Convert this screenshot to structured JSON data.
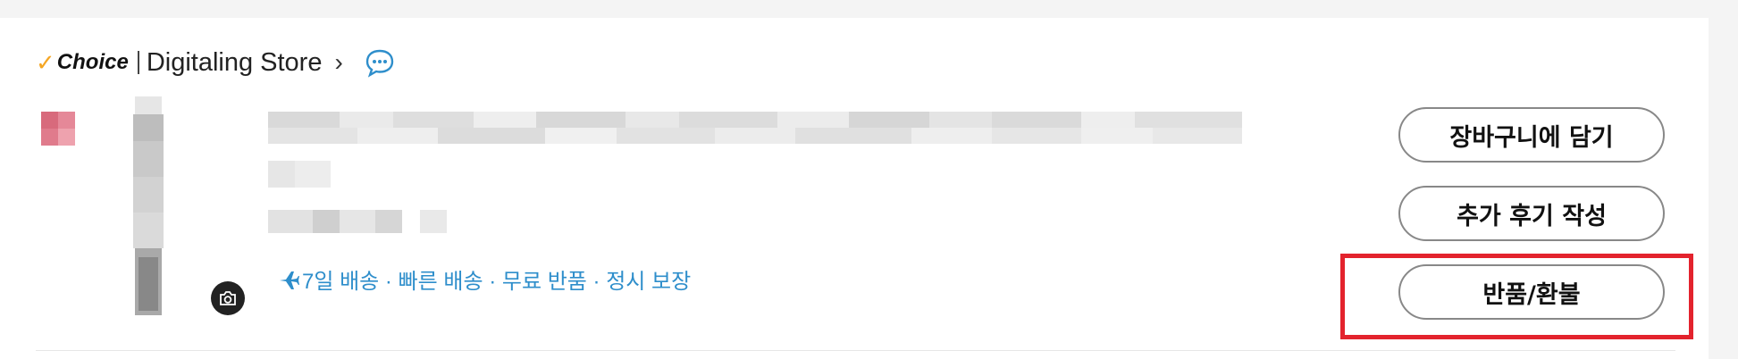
{
  "store": {
    "choice_label": "Choice",
    "name": "Digitaling Store",
    "chevron": "›"
  },
  "icons": {
    "check": "checkmark-icon",
    "chat": "chat-bubble-icon",
    "camera": "camera-icon",
    "plane": "airplane-icon"
  },
  "product": {
    "shipping_text": "7일 배송 · 빠른 배송 · 무료 반품 · 정시 보장"
  },
  "actions": {
    "add_to_cart": "장바구니에 담기",
    "write_review": "추가 후기 작성",
    "return_refund": "반품/환불"
  },
  "colors": {
    "accent_blue": "#2e8ecb",
    "choice_check": "#f5a623",
    "highlight_red": "#e3232d"
  }
}
